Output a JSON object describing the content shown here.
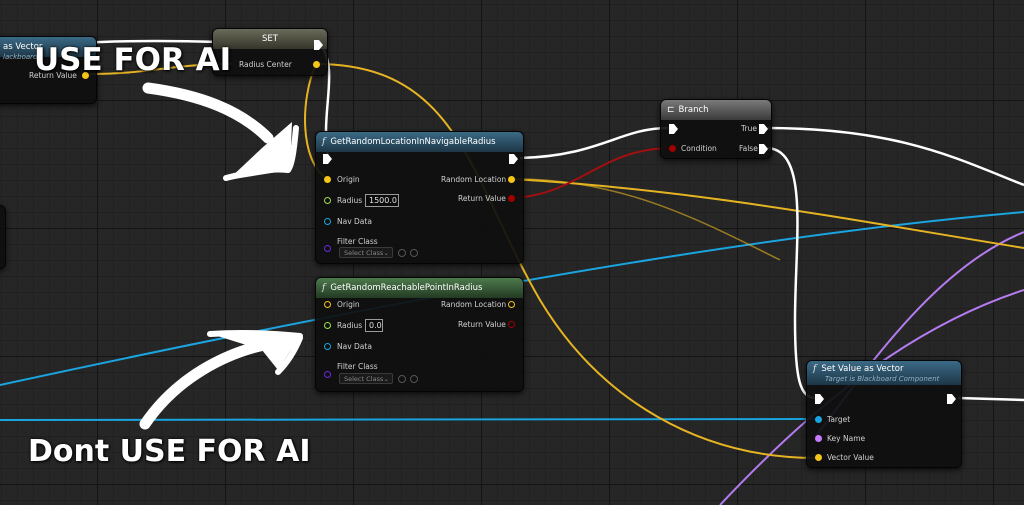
{
  "annotations": {
    "top": "USE  FOR AI",
    "bottom": "Dont USE  FOR AI"
  },
  "colors": {
    "exec": "#ffffff",
    "vector": "#f5c518",
    "float": "#9de04a",
    "object": "#1aa4e0",
    "name": "#c77cff",
    "bool": "#a00000",
    "class": "#6a2adf",
    "func_header": "#2e5a75",
    "pure_header": "#3f6a3f"
  },
  "nodes": {
    "blackboard_get": {
      "title": "as Vector",
      "subtitle": "lackboard",
      "return_label": "Return Value"
    },
    "set": {
      "title": "SET",
      "pin_label": "Radius Center"
    },
    "get_random_location": {
      "icon": "f",
      "title": "GetRandomLocationInNavigableRadius",
      "pins_in": [
        "Origin",
        "Radius",
        "Nav Data",
        "Filter Class"
      ],
      "pins_out": [
        "Random Location",
        "Return Value"
      ],
      "radius_value": "1500.0",
      "filter_select": "Select Class"
    },
    "get_random_reachable": {
      "icon": "f",
      "title": "GetRandomReachablePointInRadius",
      "pins_in": [
        "Origin",
        "Radius",
        "Nav Data",
        "Filter Class"
      ],
      "pins_out": [
        "Random Location",
        "Return Value"
      ],
      "radius_value": "0.0",
      "filter_select": "Select Class"
    },
    "branch": {
      "title": "Branch",
      "pin_in": "Condition",
      "pin_true": "True",
      "pin_false": "False"
    },
    "set_value_as_vector": {
      "icon": "f",
      "title": "Set Value as Vector",
      "subtitle": "Target is Blackboard Component",
      "pins_in": [
        "Target",
        "Key Name",
        "Vector Value"
      ]
    }
  }
}
